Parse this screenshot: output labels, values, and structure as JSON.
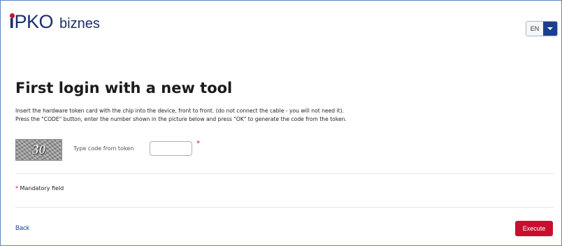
{
  "header": {
    "logo": {
      "i": "i",
      "pko": "PKO",
      "biznes": "biznes"
    },
    "language": {
      "code": "EN",
      "dropdown_icon": "chevron-down-icon"
    }
  },
  "main": {
    "title": "First login with a new tool",
    "instructions": [
      "Insert the hardware token card with the chip into the device, front to front. (do not connect the cable - you will not need it).",
      "Press the \"CODE\" button, enter the number shown in the picture below and press \"OK\" to generate the code from the token."
    ],
    "token_image_number": "30",
    "code_field": {
      "label": "Type code from token",
      "value": "",
      "placeholder": "",
      "required_mark": "*"
    },
    "mandatory_note": {
      "star": "*",
      "text": " Mandatory field"
    }
  },
  "footer": {
    "back_label": "Back",
    "execute_label": "Execute"
  },
  "colors": {
    "brand_navy": "#1a2f6b",
    "brand_red": "#c8102e",
    "link_blue": "#1b3f8f",
    "frame_border": "#5b86c5"
  }
}
